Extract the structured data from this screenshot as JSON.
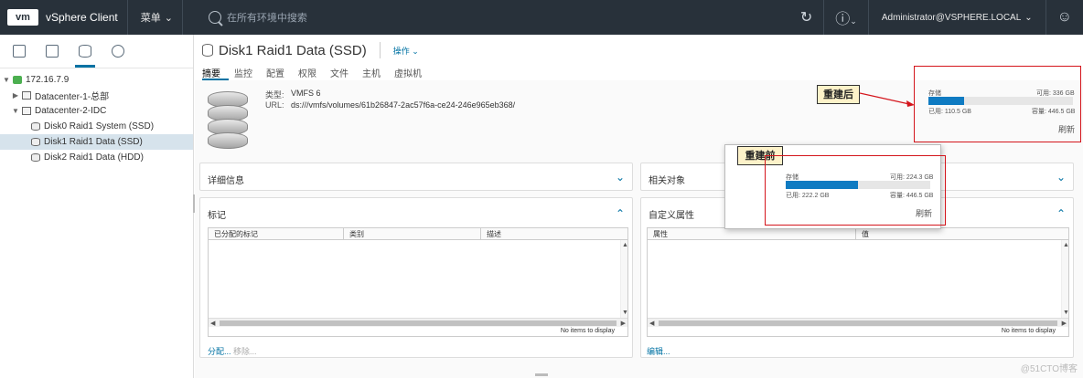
{
  "header": {
    "logo": "vm",
    "app_title": "vSphere Client",
    "menu_label": "菜单",
    "search_placeholder": "在所有环境中搜索",
    "user": "Administrator@VSPHERE.LOCAL"
  },
  "tree": {
    "root": "172.16.7.9",
    "items": [
      {
        "label": "Datacenter-1-总部"
      },
      {
        "label": "Datacenter-2-IDC"
      },
      {
        "label": "Disk0 Raid1 System (SSD)"
      },
      {
        "label": "Disk1 Raid1 Data (SSD)"
      },
      {
        "label": "Disk2 Raid1 Data (HDD)"
      }
    ]
  },
  "object": {
    "title": "Disk1 Raid1 Data (SSD)",
    "actions_label": "操作",
    "tabs": [
      "摘要",
      "监控",
      "配置",
      "权限",
      "文件",
      "主机",
      "虚拟机"
    ],
    "type_label": "类型:",
    "type_value": "VMFS 6",
    "url_label": "URL:",
    "url_value": "ds:///vmfs/volumes/61b26847-2ac57f6a-ce24-246e965eb368/"
  },
  "cards": {
    "details_title": "详细信息",
    "related_title": "相关对象",
    "tags_title": "标记",
    "custom_title": "自定义属性",
    "tags_columns": [
      "已分配的标记",
      "类别",
      "描述"
    ],
    "custom_columns": [
      "属性",
      "值"
    ],
    "no_items": "No items to display",
    "assign_label": "分配...",
    "remove_label": "移除...",
    "edit_label": "编辑..."
  },
  "storage_after": {
    "label": "存储",
    "free": "可用: 336 GB",
    "used": "已用: 110.5 GB",
    "capacity": "容量: 446.5 GB",
    "refresh": "刷新",
    "used_fraction": 0.247
  },
  "storage_before": {
    "label": "存储",
    "free": "可用: 224.3 GB",
    "used": "已用: 222.2 GB",
    "capacity": "容量: 446.5 GB",
    "refresh": "刷新",
    "used_fraction": 0.498
  },
  "callouts": {
    "after": "重建后",
    "before": "重建前"
  },
  "watermark": "@51CTO博客",
  "colors": {
    "header_bg": "#28313a",
    "accent": "#0072a3",
    "bar": "#0f7bc2",
    "annotation_red": "#d4151c",
    "callout_bg": "#fdf2c9"
  }
}
